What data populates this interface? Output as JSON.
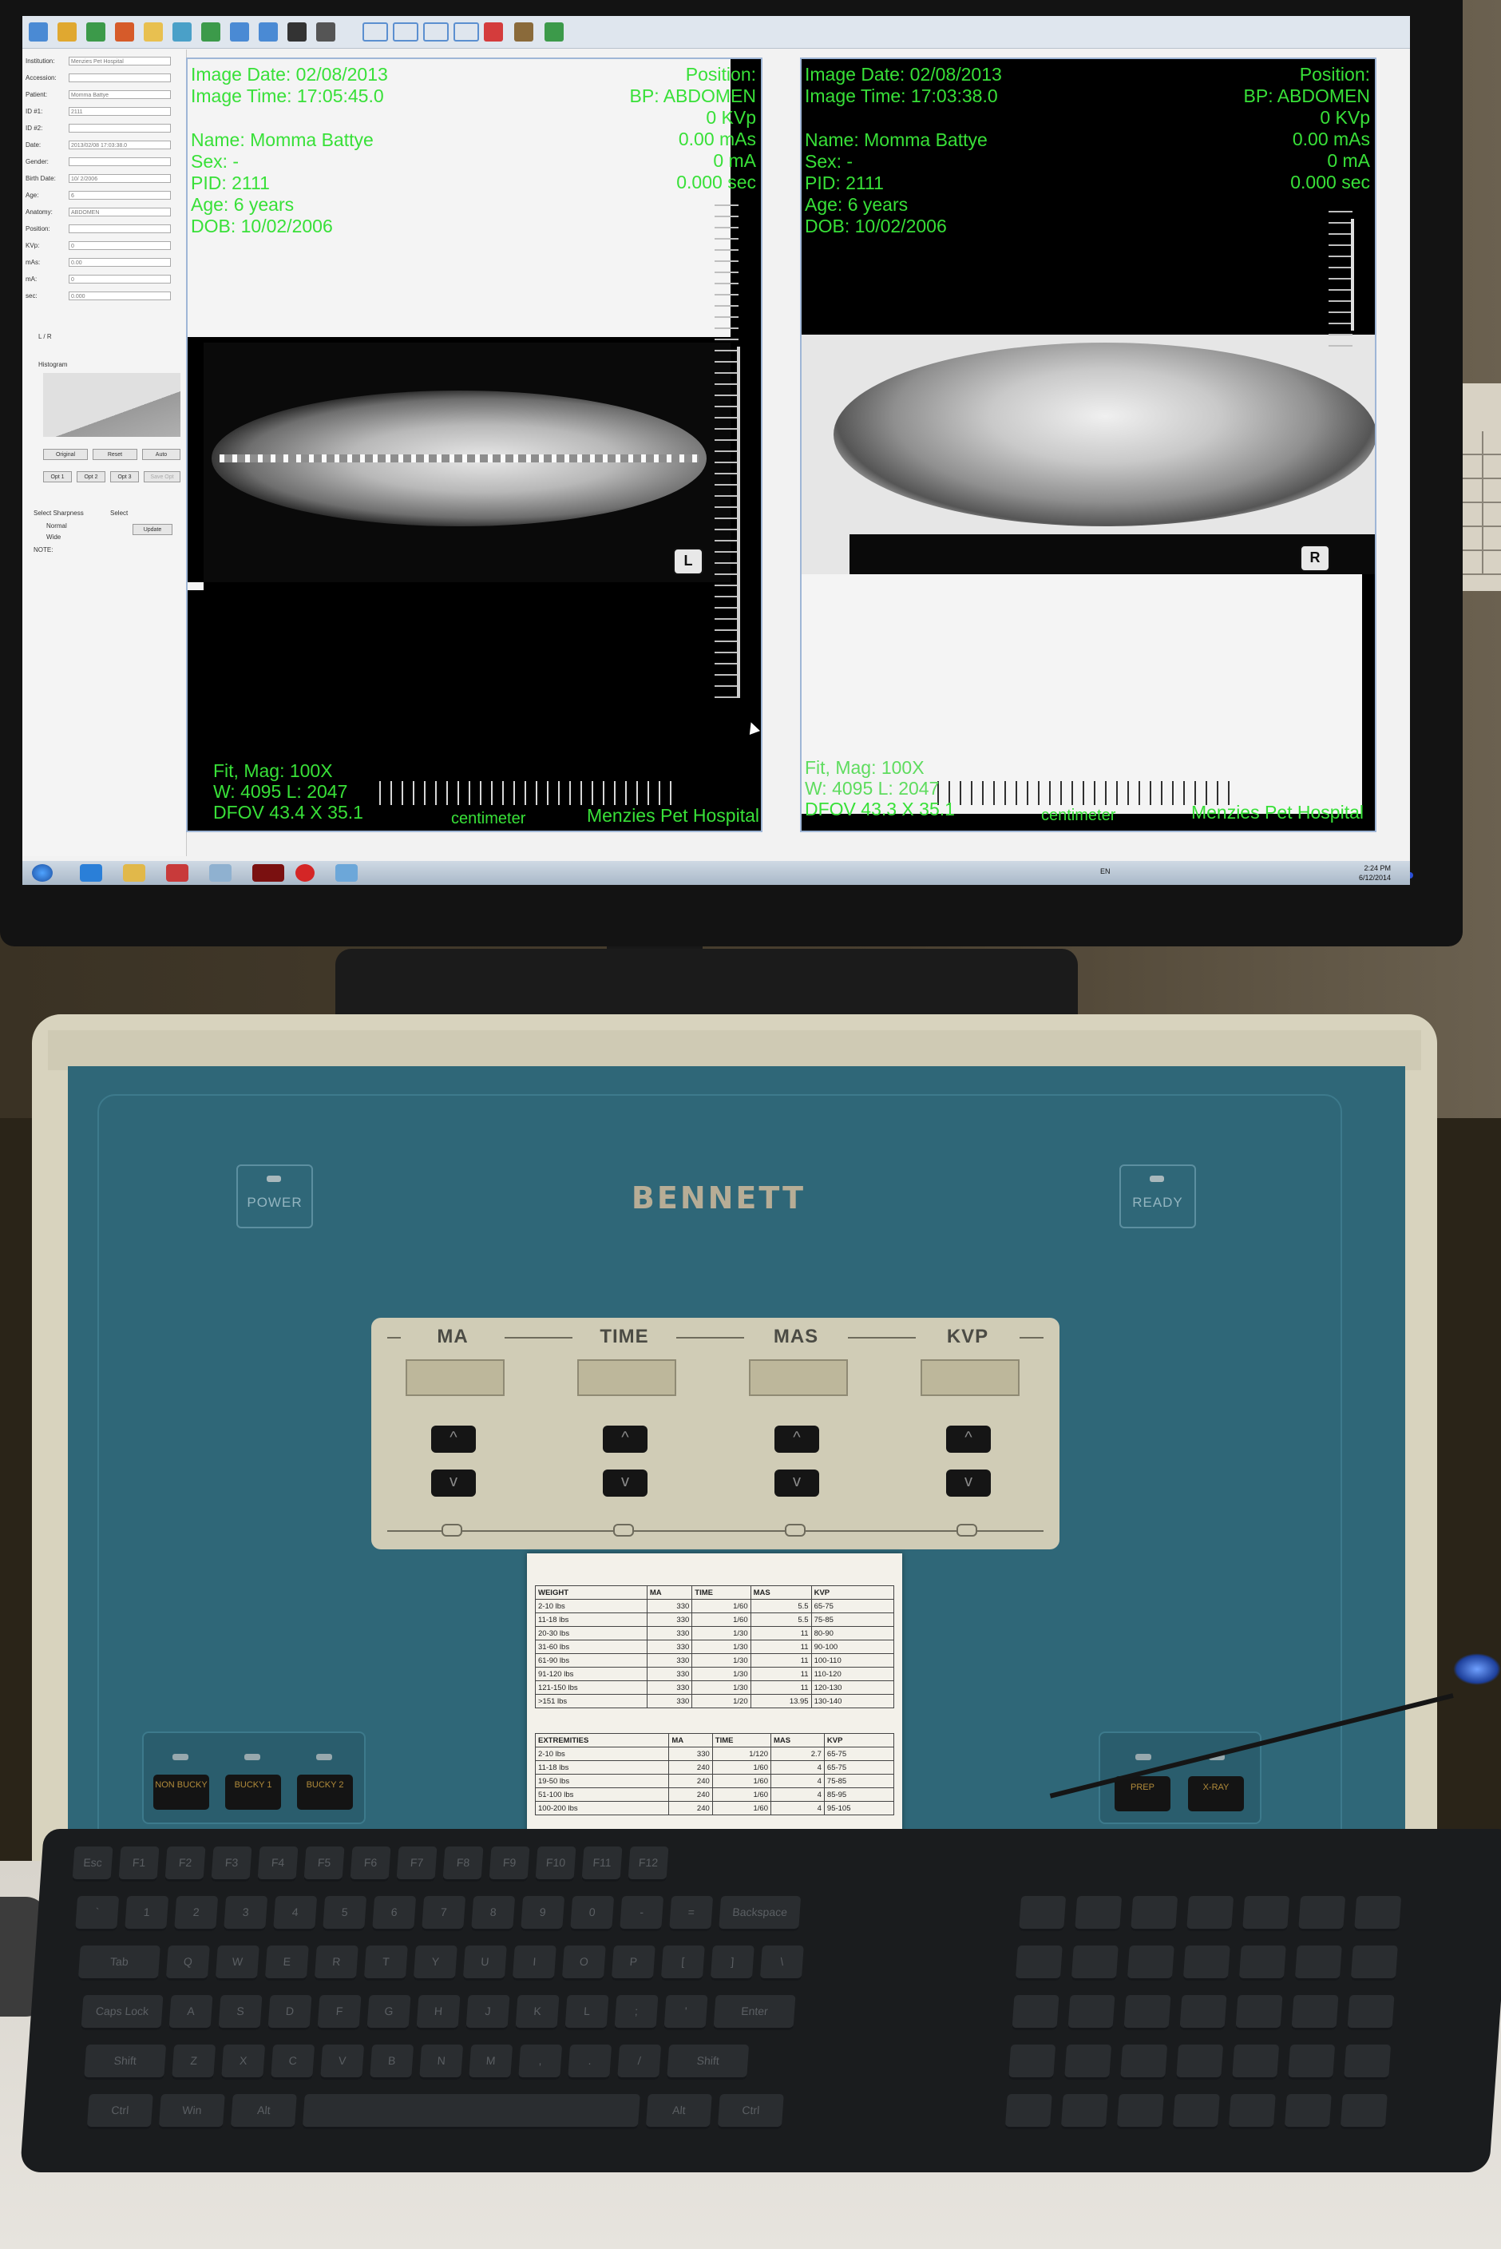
{
  "screen": {
    "toolbar_icons": [
      "open-icon",
      "save-icon",
      "print-icon",
      "export-icon",
      "folder-icon",
      "rotate-icon",
      "flip-icon",
      "undo-icon",
      "redo-icon",
      "invert-icon",
      "measure-icon",
      "layout-1-icon",
      "layout-2-icon",
      "layout-3-icon",
      "layout-4-icon",
      "annotate-icon",
      "tools-icon",
      "lock-icon"
    ],
    "side_panel": {
      "rows": [
        {
          "label": "Institution:",
          "value": "Menzies Pet Hospital"
        },
        {
          "label": "Accession:",
          "value": ""
        },
        {
          "label": "Patient:",
          "value": "Momma Battye"
        },
        {
          "label": "ID #1:",
          "value": "2111"
        },
        {
          "label": "ID #2:",
          "value": ""
        },
        {
          "label": "Date:",
          "value": "2013/02/08 17:03:38.0"
        },
        {
          "label": "Gender:",
          "value": ""
        },
        {
          "label": "Birth Date:",
          "value": "10/ 2/2006"
        },
        {
          "label": "Age:",
          "value": "6"
        },
        {
          "label": "Anatomy:",
          "value": "ABDOMEN"
        },
        {
          "label": "Position:",
          "value": ""
        },
        {
          "label": "KVp:",
          "value": "0"
        },
        {
          "label": "mAs:",
          "value": "0.00"
        },
        {
          "label": "mA:",
          "value": "0"
        },
        {
          "label": "sec:",
          "value": "0.000"
        }
      ],
      "lr_label": "L / R",
      "histogram_label": "Histogram",
      "buttons_row1": [
        "Original",
        "Reset",
        "Auto"
      ],
      "buttons_row2": [
        "Opt 1",
        "Opt 2",
        "Opt 3",
        "Save Opt"
      ],
      "sharpness_label": "Select Sharpness",
      "select_label": "Select",
      "normal_label": "Normal",
      "wide_label": "Wide",
      "update_label": "Update",
      "note_label": "NOTE:"
    },
    "left_view": {
      "image_date": "Image Date: 02/08/2013",
      "image_time": "Image Time: 17:05:45.0",
      "name": "Name: Momma Battye",
      "sex": "Sex: -",
      "pid": "PID: 2111",
      "age": "Age: 6 years",
      "dob": "DOB: 10/02/2006",
      "position": "Position:",
      "bp": "BP: ABDOMEN",
      "kvp": "0 KVp",
      "mas": "0.00 mAs",
      "ma": "0 mA",
      "sec": "0.000 sec",
      "fit": "Fit, Mag: 100X",
      "wl": "W: 4095 L: 2047",
      "dfov": "DFOV 43.4 X 35.1",
      "unit": "centimeter",
      "hospital": "Menzies Pet Hospital",
      "marker": "L"
    },
    "right_view": {
      "image_date": "Image Date: 02/08/2013",
      "image_time": "Image Time: 17:03:38.0",
      "name": "Name: Momma Battye",
      "sex": "Sex: -",
      "pid": "PID: 2111",
      "age": "Age: 6 years",
      "dob": "DOB: 10/02/2006",
      "position": "Position:",
      "bp": "BP: ABDOMEN",
      "kvp": "0 KVp",
      "mas": "0.00 mAs",
      "ma": "0 mA",
      "sec": "0.000 sec",
      "fit": "Fit, Mag: 100X",
      "wl": "W: 4095 L: 2047",
      "dfov": "DFOV 43.3 X 35.1",
      "unit": "centimeter",
      "hospital": "Menzies Pet Hospital",
      "marker": "R"
    },
    "taskbar": {
      "clock_time": "2:24 PM",
      "clock_date": "6/12/2014",
      "lang": "EN"
    },
    "colors": {
      "overlay_text": "#38e038",
      "panel": "#2f6778"
    }
  },
  "console": {
    "brand": "BENNETT",
    "power_label": "POWER",
    "ready_label": "READY",
    "readouts": [
      "MA",
      "TIME",
      "MAS",
      "KVP"
    ],
    "up_glyph": "^",
    "down_glyph": "v",
    "left_buttons": [
      "NON BUCKY",
      "BUCKY 1",
      "BUCKY 2"
    ],
    "right_buttons": [
      "PREP",
      "X-RAY"
    ]
  },
  "technique_chart": {
    "weight_header": [
      "WEIGHT",
      "MA",
      "TIME",
      "MAS",
      "KVP"
    ],
    "weight_rows": [
      [
        "2-10 lbs",
        "330",
        "1/60",
        "5.5",
        "65-75"
      ],
      [
        "11-18 lbs",
        "330",
        "1/60",
        "5.5",
        "75-85"
      ],
      [
        "20-30 lbs",
        "330",
        "1/30",
        "11",
        "80-90"
      ],
      [
        "31-60 lbs",
        "330",
        "1/30",
        "11",
        "90-100"
      ],
      [
        "61-90 lbs",
        "330",
        "1/30",
        "11",
        "100-110"
      ],
      [
        "91-120 lbs",
        "330",
        "1/30",
        "11",
        "110-120"
      ],
      [
        "121-150 lbs",
        "330",
        "1/30",
        "11",
        "120-130"
      ],
      [
        ">151 lbs",
        "330",
        "1/20",
        "13.95",
        "130-140"
      ]
    ],
    "extremities_header": [
      "EXTREMITIES",
      "MA",
      "TIME",
      "MAS",
      "KVP"
    ],
    "extremities_rows": [
      [
        "2-10 lbs",
        "330",
        "1/120",
        "2.7",
        "65-75"
      ],
      [
        "11-18 lbs",
        "240",
        "1/60",
        "4",
        "65-75"
      ],
      [
        "19-50 lbs",
        "240",
        "1/60",
        "4",
        "75-85"
      ],
      [
        "51-100 lbs",
        "240",
        "1/60",
        "4",
        "85-95"
      ],
      [
        "100-200 lbs",
        "240",
        "1/60",
        "4",
        "95-105"
      ]
    ]
  },
  "keyboard": {
    "keys_row1": [
      "Esc",
      "F1",
      "F2",
      "F3",
      "F4",
      "F5",
      "F6",
      "F7",
      "F8",
      "F9",
      "F10",
      "F11",
      "F12"
    ],
    "keys_row2": [
      "`",
      "1",
      "2",
      "3",
      "4",
      "5",
      "6",
      "7",
      "8",
      "9",
      "0",
      "-",
      "=",
      "Backspace"
    ],
    "keys_row3": [
      "Tab",
      "Q",
      "W",
      "E",
      "R",
      "T",
      "Y",
      "U",
      "I",
      "O",
      "P",
      "[",
      "]",
      "\\"
    ],
    "keys_row4": [
      "Caps Lock",
      "A",
      "S",
      "D",
      "F",
      "G",
      "H",
      "J",
      "K",
      "L",
      ";",
      "'",
      "Enter"
    ],
    "keys_row5": [
      "Shift",
      "Z",
      "X",
      "C",
      "V",
      "B",
      "N",
      "M",
      ",",
      ".",
      "/",
      "Shift"
    ],
    "keys_row6": [
      "Ctrl",
      "Win",
      "Alt",
      "",
      "Alt",
      "Ctrl"
    ]
  }
}
